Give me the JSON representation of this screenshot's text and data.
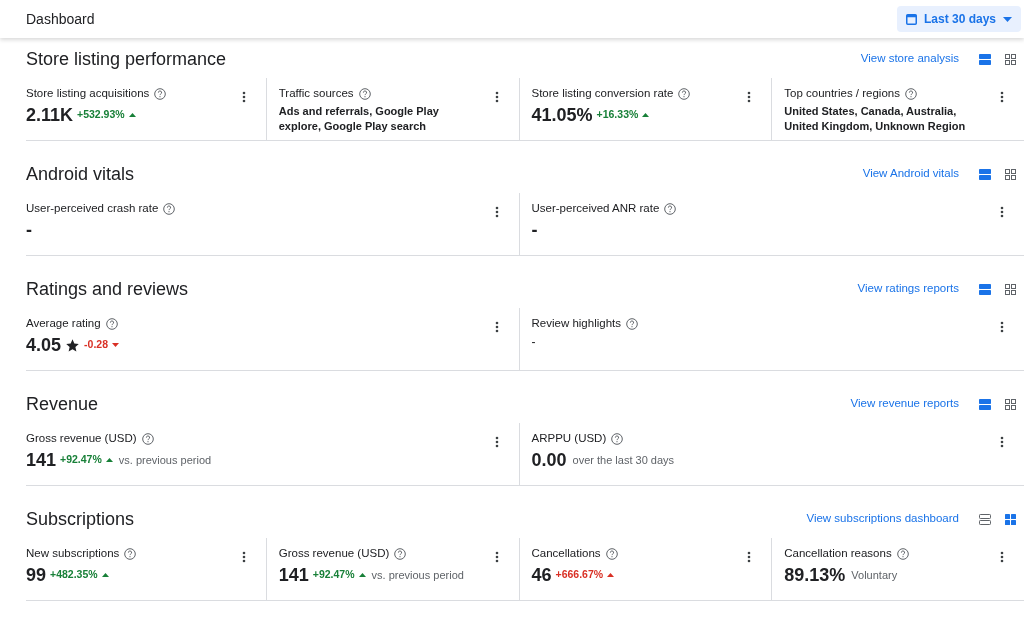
{
  "header": {
    "title": "Dashboard",
    "date_range": "Last 30 days"
  },
  "sections": [
    {
      "title": "Store listing performance",
      "link": "View store analysis",
      "views": [
        {
          "kind": "list",
          "selected": true
        },
        {
          "kind": "grid",
          "selected": false
        }
      ],
      "cards": [
        {
          "kind": "metric",
          "label": "Store listing acquisitions",
          "value": "2.11K",
          "star": false,
          "delta": {
            "text": "+532.93%",
            "increase": true,
            "favorable": true
          }
        },
        {
          "kind": "text",
          "label": "Traffic sources",
          "value": "Ads and referrals, Google Play explore, Google Play search"
        },
        {
          "kind": "metric",
          "label": "Store listing conversion rate",
          "value": "41.05%",
          "star": false,
          "delta": {
            "text": "+16.33%",
            "increase": true,
            "favorable": true
          }
        },
        {
          "kind": "text",
          "label": "Top countries / regions",
          "value": "United States, Canada, Australia, United Kingdom, Unknown Region"
        }
      ]
    },
    {
      "title": "Android vitals",
      "link": "View Android vitals",
      "views": [
        {
          "kind": "list",
          "selected": true
        },
        {
          "kind": "grid",
          "selected": false
        }
      ],
      "cards": [
        {
          "kind": "metric",
          "label": "User-perceived crash rate",
          "value": "-",
          "star": false
        },
        {
          "kind": "metric",
          "label": "User-perceived ANR rate",
          "value": "-",
          "star": false
        }
      ]
    },
    {
      "title": "Ratings and reviews",
      "link": "View ratings reports",
      "views": [
        {
          "kind": "list",
          "selected": true
        },
        {
          "kind": "grid",
          "selected": false
        }
      ],
      "cards": [
        {
          "kind": "metric",
          "label": "Average rating",
          "value": "4.05",
          "star": true,
          "delta": {
            "text": "-0.28",
            "increase": false,
            "favorable": false
          }
        },
        {
          "kind": "plain",
          "label": "Review highlights",
          "value": "-"
        }
      ]
    },
    {
      "title": "Revenue",
      "link": "View revenue reports",
      "views": [
        {
          "kind": "list",
          "selected": true
        },
        {
          "kind": "grid",
          "selected": false
        }
      ],
      "cards": [
        {
          "kind": "metric",
          "label": "Gross revenue (USD)",
          "value": "141",
          "star": false,
          "delta": {
            "text": "+92.47%",
            "increase": true,
            "favorable": true
          },
          "note": "vs. previous period"
        },
        {
          "kind": "metric",
          "label": "ARPPU (USD)",
          "value": "0.00",
          "star": false,
          "note": "over the last 30 days"
        }
      ]
    },
    {
      "title": "Subscriptions",
      "link": "View subscriptions dashboard",
      "views": [
        {
          "kind": "list",
          "selected": false
        },
        {
          "kind": "grid",
          "selected": true
        }
      ],
      "cards": [
        {
          "kind": "metric",
          "label": "New subscriptions",
          "value": "99",
          "star": false,
          "delta": {
            "text": "+482.35%",
            "increase": true,
            "favorable": true
          }
        },
        {
          "kind": "metric",
          "label": "Gross revenue (USD)",
          "value": "141",
          "star": false,
          "delta": {
            "text": "+92.47%",
            "increase": true,
            "favorable": true
          },
          "note": "vs. previous period"
        },
        {
          "kind": "metric",
          "label": "Cancellations",
          "value": "46",
          "star": false,
          "delta": {
            "text": "+666.67%",
            "increase": true,
            "favorable": false
          }
        },
        {
          "kind": "metric",
          "label": "Cancellation reasons",
          "value": "89.13%",
          "star": false,
          "note": "Voluntary"
        }
      ]
    }
  ]
}
